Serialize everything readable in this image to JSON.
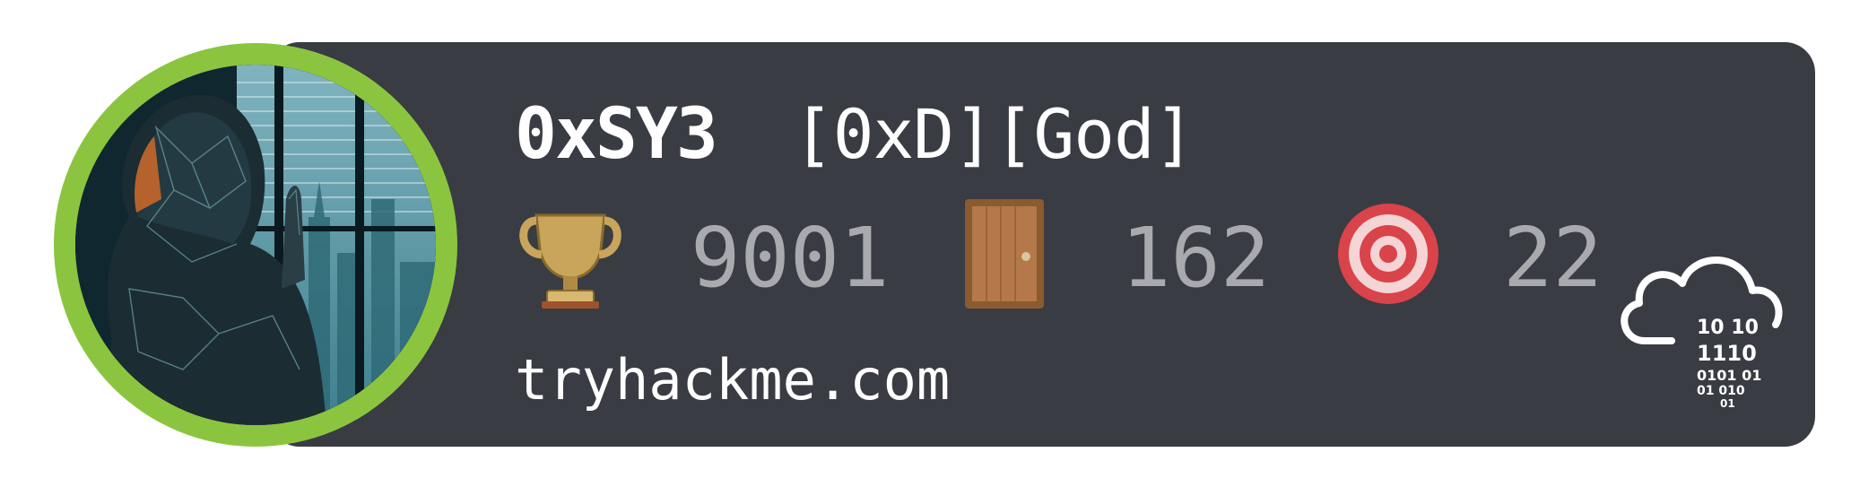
{
  "profile": {
    "username": "0xSY3",
    "rank": "[0xD][God]",
    "site": "tryhackme.com"
  },
  "stats": [
    {
      "icon": "trophy-icon",
      "value": "9001"
    },
    {
      "icon": "door-icon",
      "value": "162"
    },
    {
      "icon": "target-icon",
      "value": "22"
    }
  ],
  "logo": {
    "icon": "tryhackme-cloud-logo",
    "binary_lines": [
      "10 10",
      "1110",
      "0101 01",
      "01 010",
      "01"
    ]
  },
  "colors": {
    "card_background": "#393c43",
    "avatar_ring": "#8bc53f",
    "stat_value": "#a8aaae",
    "text": "#ffffff"
  }
}
